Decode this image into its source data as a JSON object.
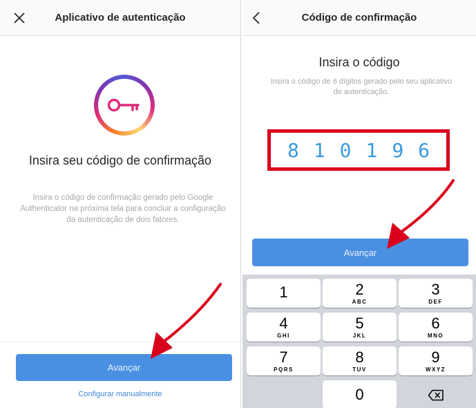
{
  "left_screen": {
    "header_title": "Aplicativo de autenticação",
    "close_icon": "close-icon",
    "key_icon": "key-icon",
    "title": "Insira seu código de confirmação",
    "description": "Insira o código de confirmação gerado pelo Google Authenticator na próxima tela para concluir a configuração da autenticação de dois fatores.",
    "primary_button": "Avançar",
    "secondary_link": "Configurar manualmente"
  },
  "right_screen": {
    "header_title": "Código de confirmação",
    "back_icon": "chevron-left-icon",
    "title": "Insira o código",
    "description": "Insira o código de 6 dígitos gerado pelo seu aplicativo de autenticação.",
    "code_digits": [
      "8",
      "1",
      "0",
      "1",
      "9",
      "6"
    ],
    "primary_button": "Avançar"
  },
  "keypad": {
    "keys": [
      {
        "num": "1",
        "letters": ""
      },
      {
        "num": "2",
        "letters": "ABC"
      },
      {
        "num": "3",
        "letters": "DEF"
      },
      {
        "num": "4",
        "letters": "GHI"
      },
      {
        "num": "5",
        "letters": "JKL"
      },
      {
        "num": "6",
        "letters": "MNO"
      },
      {
        "num": "7",
        "letters": "PQRS"
      },
      {
        "num": "8",
        "letters": "TUV"
      },
      {
        "num": "9",
        "letters": "WXYZ"
      },
      {
        "num": "0",
        "letters": ""
      }
    ],
    "delete_icon": "backspace-icon"
  },
  "colors": {
    "accent_blue": "#4a90e2",
    "highlight_red": "#d9001b",
    "digit_blue": "#3a9be0",
    "annotation_arrow": "#d9001b"
  }
}
